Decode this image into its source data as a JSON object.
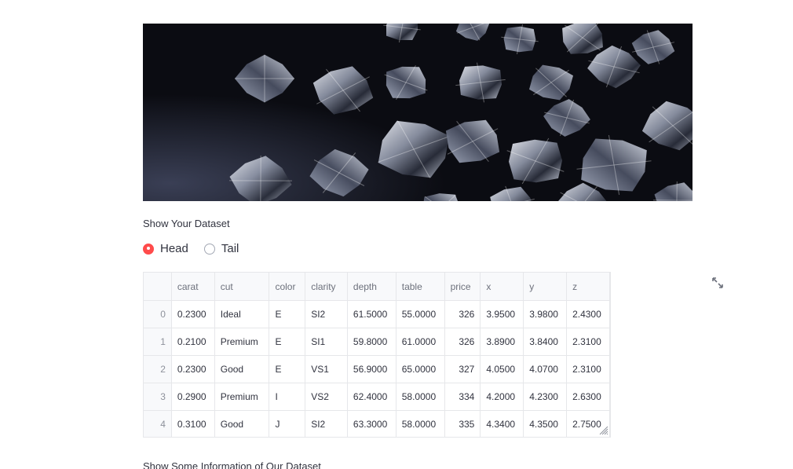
{
  "hero": {
    "icon": "diamonds-image"
  },
  "dataset_label": "Show Your Dataset",
  "radio": {
    "options": [
      {
        "label": "Head",
        "checked": true
      },
      {
        "label": "Tail",
        "checked": false
      }
    ],
    "accent": "#ff4b4b"
  },
  "table": {
    "columns": [
      "",
      "carat",
      "cut",
      "color",
      "clarity",
      "depth",
      "table",
      "price",
      "x",
      "y",
      "z"
    ],
    "rows": [
      [
        "0",
        "0.2300",
        "Ideal",
        "E",
        "SI2",
        "61.5000",
        "55.0000",
        "326",
        "3.9500",
        "3.9800",
        "2.4300"
      ],
      [
        "1",
        "0.2100",
        "Premium",
        "E",
        "SI1",
        "59.8000",
        "61.0000",
        "326",
        "3.8900",
        "3.8400",
        "2.3100"
      ],
      [
        "2",
        "0.2300",
        "Good",
        "E",
        "VS1",
        "56.9000",
        "65.0000",
        "327",
        "4.0500",
        "4.0700",
        "2.3100"
      ],
      [
        "3",
        "0.2900",
        "Premium",
        "I",
        "VS2",
        "62.4000",
        "58.0000",
        "334",
        "4.2000",
        "4.2300",
        "2.6300"
      ],
      [
        "4",
        "0.3100",
        "Good",
        "J",
        "SI2",
        "63.3000",
        "58.0000",
        "335",
        "4.3400",
        "4.3500",
        "2.7500"
      ]
    ]
  },
  "info_label": "Show Some Information of Our Dataset",
  "icons": {
    "expand": "expand-icon",
    "resize": "resize-handle-icon"
  }
}
